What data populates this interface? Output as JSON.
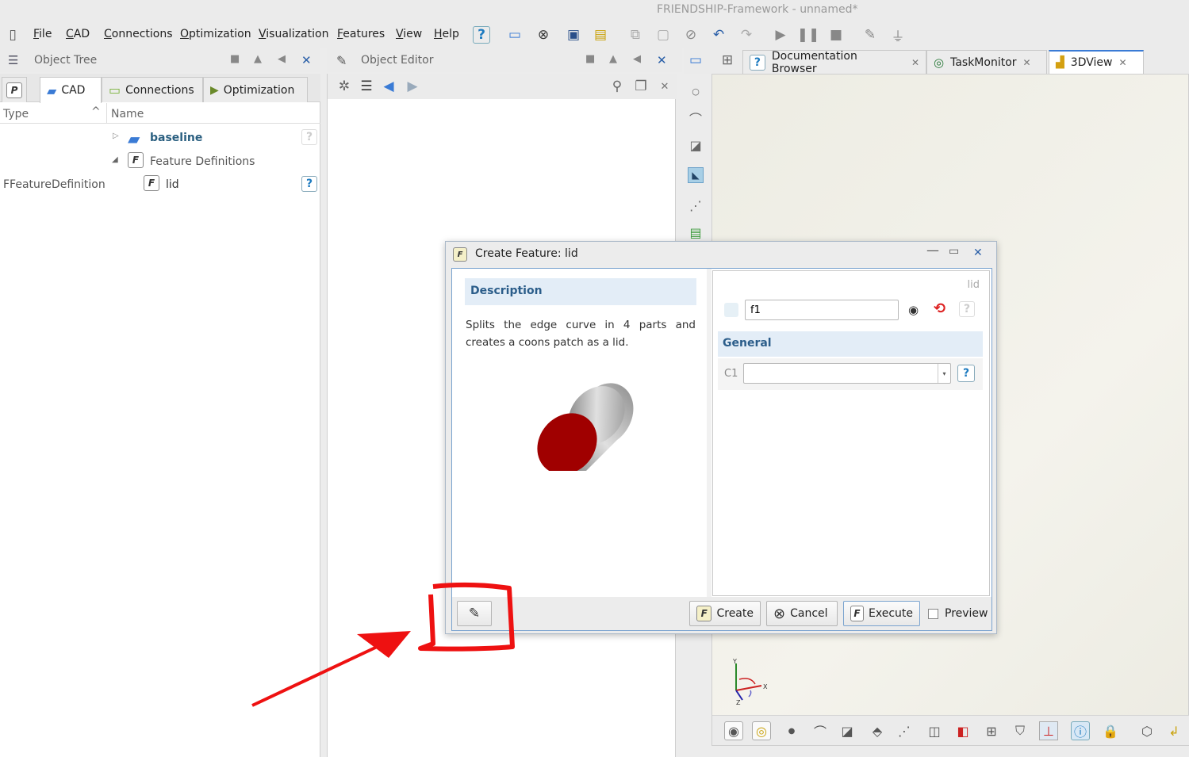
{
  "window": {
    "title": "FRIENDSHIP-Framework - unnamed*"
  },
  "menu": [
    "File",
    "CAD",
    "Connections",
    "Optimization",
    "Visualization",
    "Features",
    "View",
    "Help"
  ],
  "object_tree": {
    "title": "Object Tree",
    "tabs": [
      {
        "label": "P"
      },
      {
        "label": "CAD"
      },
      {
        "label": "Connections"
      },
      {
        "label": "Optimization"
      }
    ],
    "columns": {
      "type": "Type",
      "name": "Name"
    },
    "rows": [
      {
        "type": "",
        "name": "baseline"
      },
      {
        "type": "",
        "name": "Feature Definitions"
      },
      {
        "type": "FFeatureDefinition",
        "name": "lid"
      }
    ]
  },
  "object_editor": {
    "title": "Object Editor"
  },
  "view_tabs": [
    {
      "label": "Documentation Browser"
    },
    {
      "label": "TaskMonitor"
    },
    {
      "label": "3DView"
    }
  ],
  "dialog": {
    "title": "Create Feature: lid",
    "description_header": "Description",
    "description_text": "Splits the edge curve in 4 parts and creates a coons patch as a lid.",
    "prop_type": "lid",
    "name_value": "f1",
    "general_header": "General",
    "c1_label": "C1",
    "c1_value": "",
    "buttons": {
      "create": "Create",
      "cancel": "Cancel",
      "execute": "Execute",
      "preview": "Preview"
    }
  },
  "axes": {
    "y": "Y",
    "x": "X",
    "z": "Z"
  },
  "colors": {
    "accent": "#2a5fa8",
    "annotation": "#ee1111",
    "lid_red": "#a00000"
  }
}
